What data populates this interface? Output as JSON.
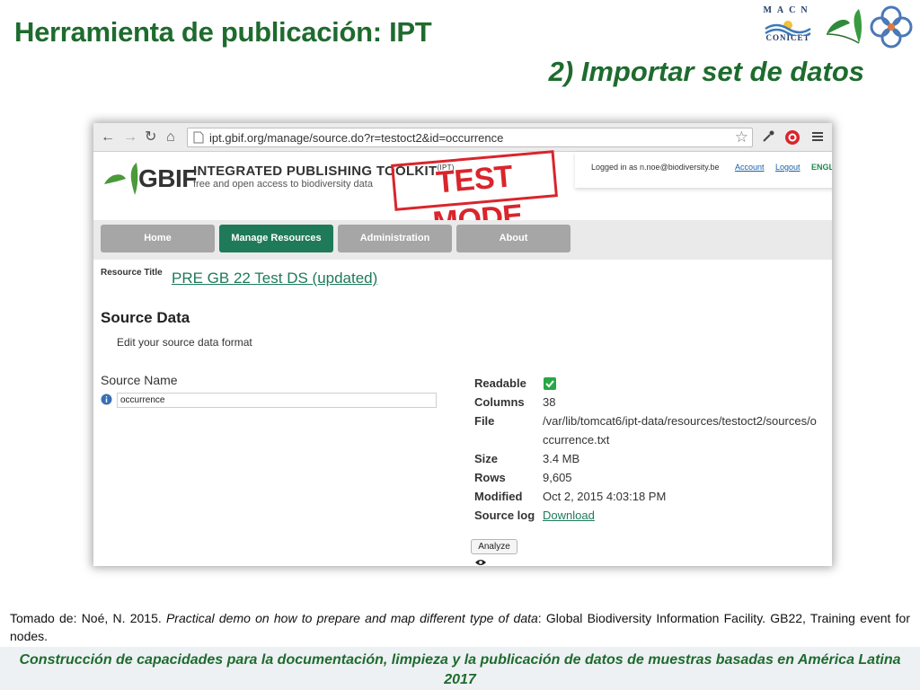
{
  "slide": {
    "title": "Herramienta de publicación: IPT",
    "subtitle": "2) Importar set de datos",
    "logo_macn_top": "MACN",
    "logo_macn_bottom": "CONICET"
  },
  "browser": {
    "url": "ipt.gbif.org/manage/source.do?r=testoct2&id=occurrence"
  },
  "gbif": {
    "wordmark": "GBIF",
    "toolkit_title": "INTEGRATED PUBLISHING TOOLKIT",
    "toolkit_abbrev": "(IPT)",
    "toolkit_subtitle": "free and open access to biodiversity data",
    "test_mode": "TEST MODE",
    "logged_in": "Logged in as n.noe@biodiversity.be",
    "account": "Account",
    "logout": "Logout",
    "language": "ENGL"
  },
  "nav": {
    "home": "Home",
    "manage": "Manage Resources",
    "admin": "Administration",
    "about": "About"
  },
  "resource": {
    "title_label": "Resource Title",
    "title_value": "PRE GB 22 Test DS (updated)",
    "heading": "Source Data",
    "description": "Edit your source data format",
    "source_name_label": "Source Name",
    "source_name_value": "occurrence"
  },
  "properties": {
    "readable_label": "Readable",
    "columns_label": "Columns",
    "columns_value": "38",
    "file_label": "File",
    "file_value": "/var/lib/tomcat6/ipt-data/resources/testoct2/sources/occurrence.txt",
    "size_label": "Size",
    "size_value": "3.4 MB",
    "rows_label": "Rows",
    "rows_value": "9,605",
    "modified_label": "Modified",
    "modified_value": "Oct 2, 2015 4:03:18 PM",
    "log_label": "Source log",
    "log_value": "Download"
  },
  "actions": {
    "analyze": "Analyze"
  },
  "citation": {
    "prefix": "Tomado de: Noé, N. 2015. ",
    "work": "Practical demo on how to prepare and map different type of data",
    "suffix": ": Global Biodiversity Information Facility. GB22, Training event  for nodes."
  },
  "footer": {
    "text": "Construcción de capacidades para la documentación, limpieza y la publicación de datos de muestras basadas en América Latina 2017"
  },
  "colors": {
    "title_green": "#1e6b2e",
    "active_tab": "#1f7a5a",
    "test_mode_red": "#d9252c"
  }
}
